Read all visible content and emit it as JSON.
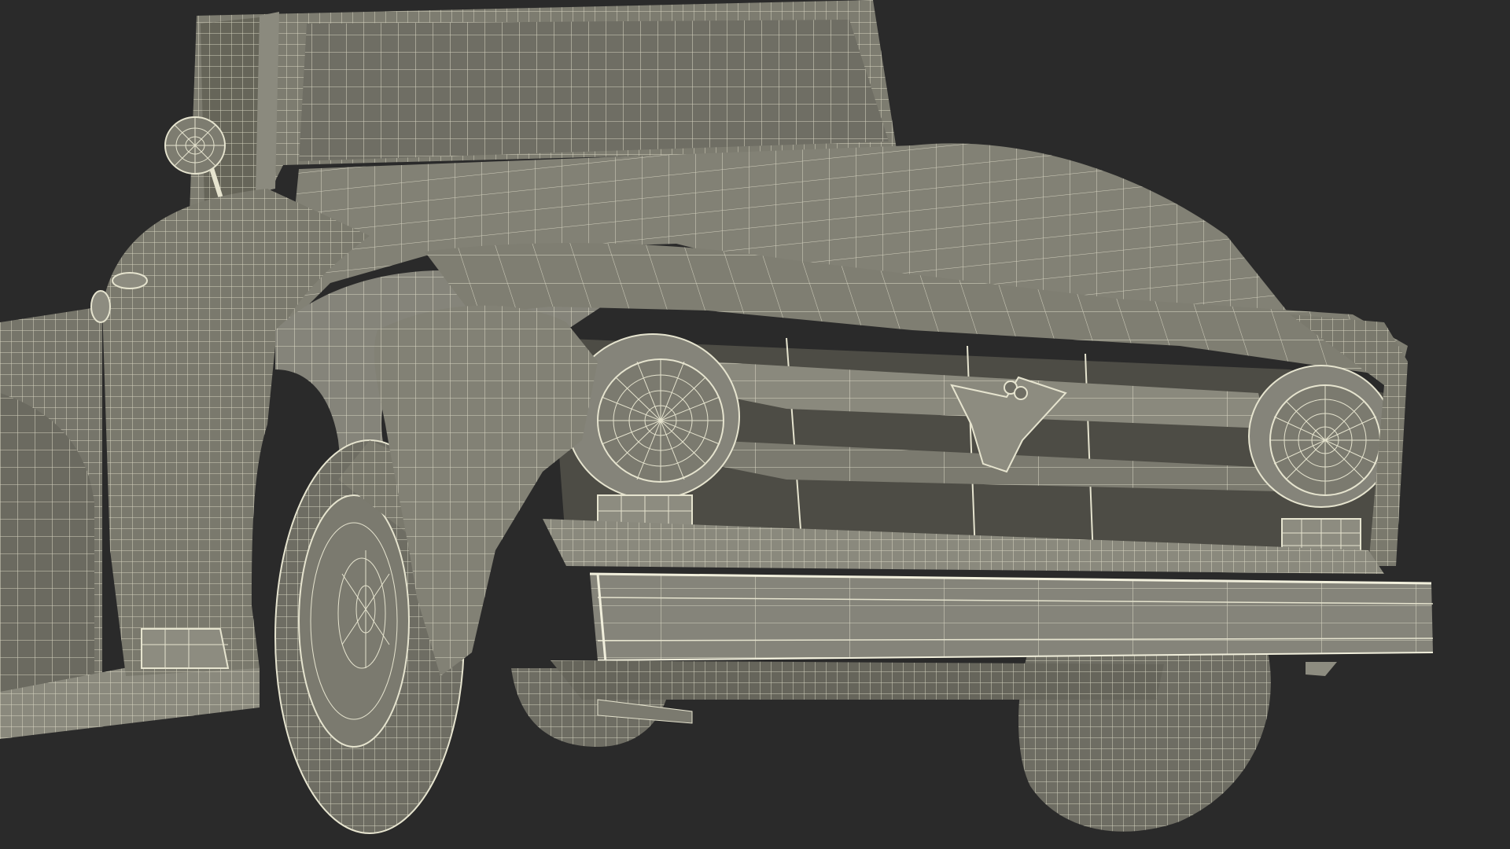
{
  "scene": {
    "subject": "pickup-truck-front",
    "render_style": "wireframe-shaded",
    "colors": {
      "background": "#2a2a2a",
      "body_fill": "#7c7b6e",
      "body_fill_dark": "#5f5e55",
      "body_fill_light": "#8d8c80",
      "shadow_fill": "#44433d",
      "tire_fill": "#6e6d63",
      "wire": "#e6e4cf",
      "wire_dense": "#f1efdc"
    }
  }
}
